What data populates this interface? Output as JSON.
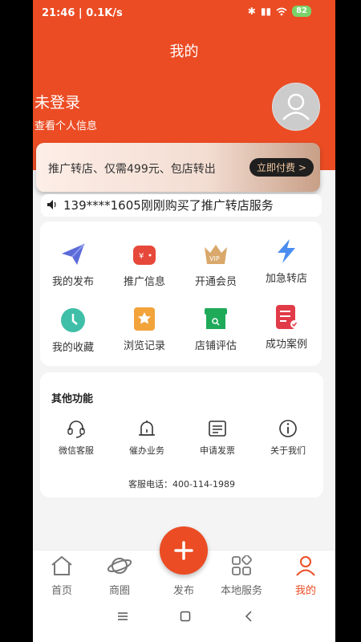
{
  "status": {
    "time": "21:46",
    "speed": "0.1K/s",
    "battery": "82"
  },
  "header": {
    "title": "我的"
  },
  "profile": {
    "login_label": "未登录",
    "sub_label": "查看个人信息"
  },
  "promo": {
    "text": "推广转店、仅需499元、包店转出",
    "button": "立即付费 >"
  },
  "ticker": {
    "message": "139****1605刚刚购买了推广转店服务"
  },
  "grid": {
    "items": [
      {
        "label": "我的发布",
        "icon": "paper-plane-icon"
      },
      {
        "label": "推广信息",
        "icon": "wallet-icon"
      },
      {
        "label": "开通会员",
        "icon": "vip-crown-icon"
      },
      {
        "label": "加急转店",
        "icon": "lightning-icon"
      },
      {
        "label": "我的收藏",
        "icon": "clock-icon"
      },
      {
        "label": "浏览记录",
        "icon": "star-bookmark-icon"
      },
      {
        "label": "店铺评估",
        "icon": "store-search-icon"
      },
      {
        "label": "成功案例",
        "icon": "document-check-icon"
      }
    ],
    "colors": {
      "blue": "#5b6bd8",
      "red": "#e6483a",
      "gold": "#d9a86a",
      "teal": "#3fbfa7",
      "orange": "#f2a33a",
      "green": "#1faa5a",
      "crimson": "#e23b48"
    }
  },
  "other": {
    "heading": "其他功能",
    "items": [
      {
        "label": "微信客服",
        "icon": "headset-icon"
      },
      {
        "label": "催办业务",
        "icon": "bell-icon"
      },
      {
        "label": "申请发票",
        "icon": "invoice-icon"
      },
      {
        "label": "关于我们",
        "icon": "info-icon"
      }
    ],
    "phone_text": "客服电话：400-114-1989"
  },
  "tabbar": {
    "items": [
      {
        "label": "首页",
        "icon": "home-icon"
      },
      {
        "label": "商圈",
        "icon": "planet-icon"
      },
      {
        "label": "发布",
        "icon": "plus-icon"
      },
      {
        "label": "本地服务",
        "icon": "apps-icon"
      },
      {
        "label": "我的",
        "icon": "user-icon"
      }
    ],
    "active_color": "#eb4c24"
  }
}
